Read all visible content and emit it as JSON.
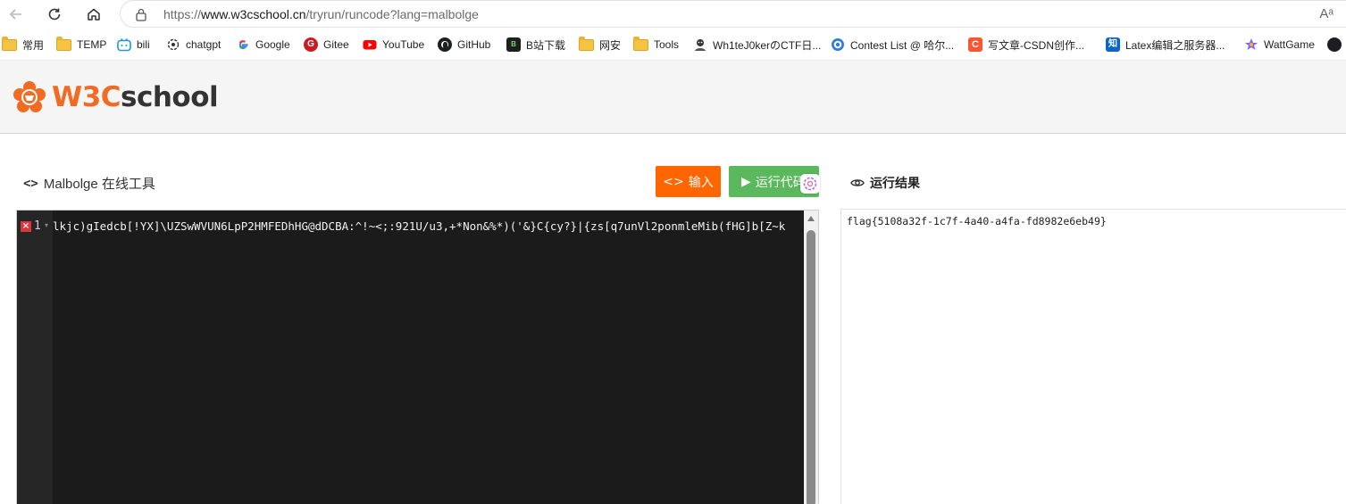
{
  "browser": {
    "url_prefix": "https://",
    "url_host": "www.w3cschool.cn",
    "url_path": "/tryrun/runcode?lang=malbolge",
    "read_aloud_label": "Aᵃ"
  },
  "bookmarks": [
    {
      "label": "常用",
      "icon": "folder-icon"
    },
    {
      "label": "TEMP",
      "icon": "folder-icon"
    },
    {
      "label": "bili",
      "icon": "bilibili-icon"
    },
    {
      "label": "chatgpt",
      "icon": "chatgpt-icon"
    },
    {
      "label": "Google",
      "icon": "google-icon"
    },
    {
      "label": "Gitee",
      "icon": "gitee-icon"
    },
    {
      "label": "YouTube",
      "icon": "youtube-icon"
    },
    {
      "label": "GitHub",
      "icon": "github-icon"
    },
    {
      "label": "B站下载",
      "icon": "bdown-icon"
    },
    {
      "label": "网安",
      "icon": "folder-icon"
    },
    {
      "label": "Tools",
      "icon": "folder-icon"
    },
    {
      "label": "Wh1teJ0kerのCTF日...",
      "icon": "joker-icon"
    },
    {
      "label": "Contest List @ 哈尔...",
      "icon": "contest-icon"
    },
    {
      "label": "写文章-CSDN创作...",
      "icon": "csdn-icon"
    },
    {
      "label": "Latex编辑之服务器...",
      "icon": "zhihu-icon"
    },
    {
      "label": "WattGame",
      "icon": "wattgame-icon"
    }
  ],
  "site": {
    "logo_w3": "W3C",
    "logo_school": "school"
  },
  "tool": {
    "title": "Malbolge 在线工具",
    "input_button": "输入",
    "run_button": "运行代码",
    "result_title": "运行结果"
  },
  "editor": {
    "line_number": "1",
    "error_marker": "×",
    "code": "lkjc)gIedcb[!YX]\\UZSwWVUN6LpP2HMFEDhHG@dDCBA:^!~<;:921U/u3,+*Non&%*)('&}C{cy?}|{zs[q7unVl2ponmleMib(fHG]b[Z~k"
  },
  "output": {
    "text": "flag{5108a32f-1c7f-4a40-a4fa-fd8982e6eb49}"
  },
  "colors": {
    "accent_orange": "#ff6600",
    "run_green": "#5cb85c",
    "logo_orange": "#f26b22",
    "editor_bg": "#1b1b1b"
  }
}
